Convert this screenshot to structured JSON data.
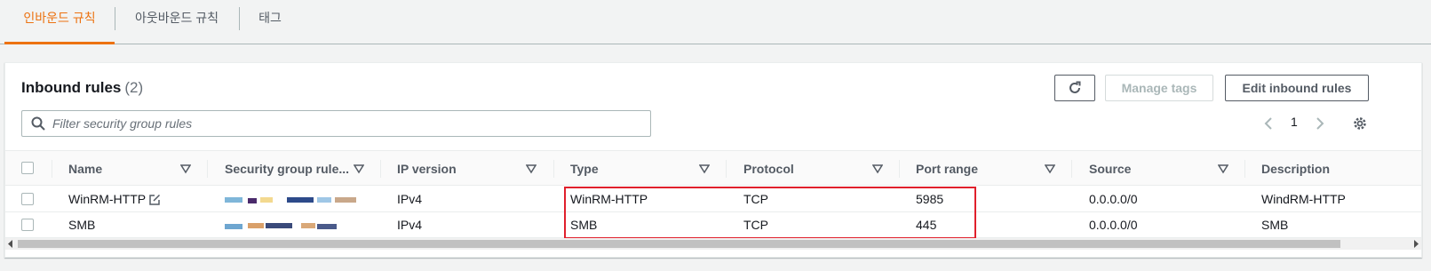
{
  "tabs": [
    {
      "label": "인바운드 규칙",
      "active": true
    },
    {
      "label": "아웃바운드 규칙",
      "active": false
    },
    {
      "label": "태그",
      "active": false
    }
  ],
  "panel": {
    "title": "Inbound rules",
    "count": "(2)",
    "manage_tags_label": "Manage tags",
    "edit_rules_label": "Edit inbound rules"
  },
  "search": {
    "placeholder": "Filter security group rules"
  },
  "pagination": {
    "current_page": "1"
  },
  "columns": [
    "Name",
    "Security group rule...",
    "IP version",
    "Type",
    "Protocol",
    "Port range",
    "Source",
    "Description"
  ],
  "rows": [
    {
      "name": "WinRM-HTTP",
      "security_group_rule": "",
      "ip_version": "IPv4",
      "type": "WinRM-HTTP",
      "protocol": "TCP",
      "port_range": "5985",
      "source": "0.0.0.0/0",
      "description": "WindRM-HTTP"
    },
    {
      "name": "SMB",
      "security_group_rule": "",
      "ip_version": "IPv4",
      "type": "SMB",
      "protocol": "TCP",
      "port_range": "445",
      "source": "0.0.0.0/0",
      "description": "SMB"
    }
  ],
  "colors": {
    "accent": "#ec7211",
    "highlight": "#e0202c"
  },
  "icons": [
    "refresh-icon",
    "search-icon",
    "chevron-left-icon",
    "chevron-right-icon",
    "settings-icon",
    "edit-icon",
    "sort-icon"
  ]
}
